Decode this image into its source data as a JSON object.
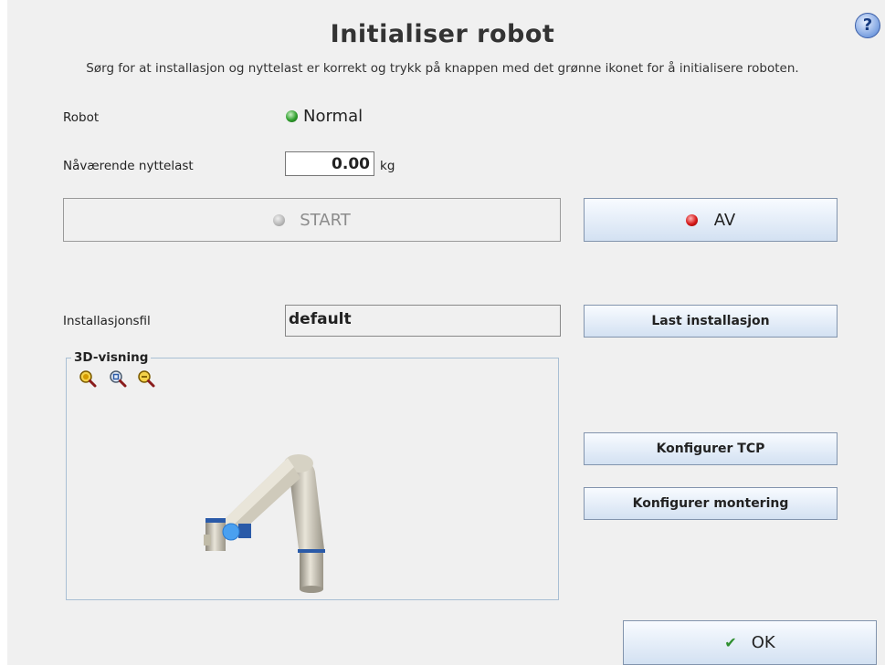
{
  "title": "Initialiser robot",
  "subtitle": "Sørg for at installasjon og nyttelast er korrekt og trykk på knappen med det grønne ikonet for å initialisere roboten.",
  "help_icon": "?",
  "robot": {
    "label": "Robot",
    "status": "Normal",
    "status_color": "#2e9e2c"
  },
  "payload": {
    "label": "Nåværende nyttelast",
    "value": "0.00",
    "unit": "kg"
  },
  "power": {
    "start_label": "START",
    "start_enabled": false,
    "off_label": "AV",
    "off_led_color": "#d51717"
  },
  "installation": {
    "label": "Installasjonsfil",
    "value": "default",
    "load_label": "Last installasjon"
  },
  "viewer": {
    "title": "3D-visning",
    "icons": [
      "zoom-in-icon",
      "zoom-fit-icon",
      "zoom-out-icon"
    ]
  },
  "buttons": {
    "configure_tcp": "Konfigurer TCP",
    "configure_mounting": "Konfigurer montering",
    "ok": "OK"
  }
}
